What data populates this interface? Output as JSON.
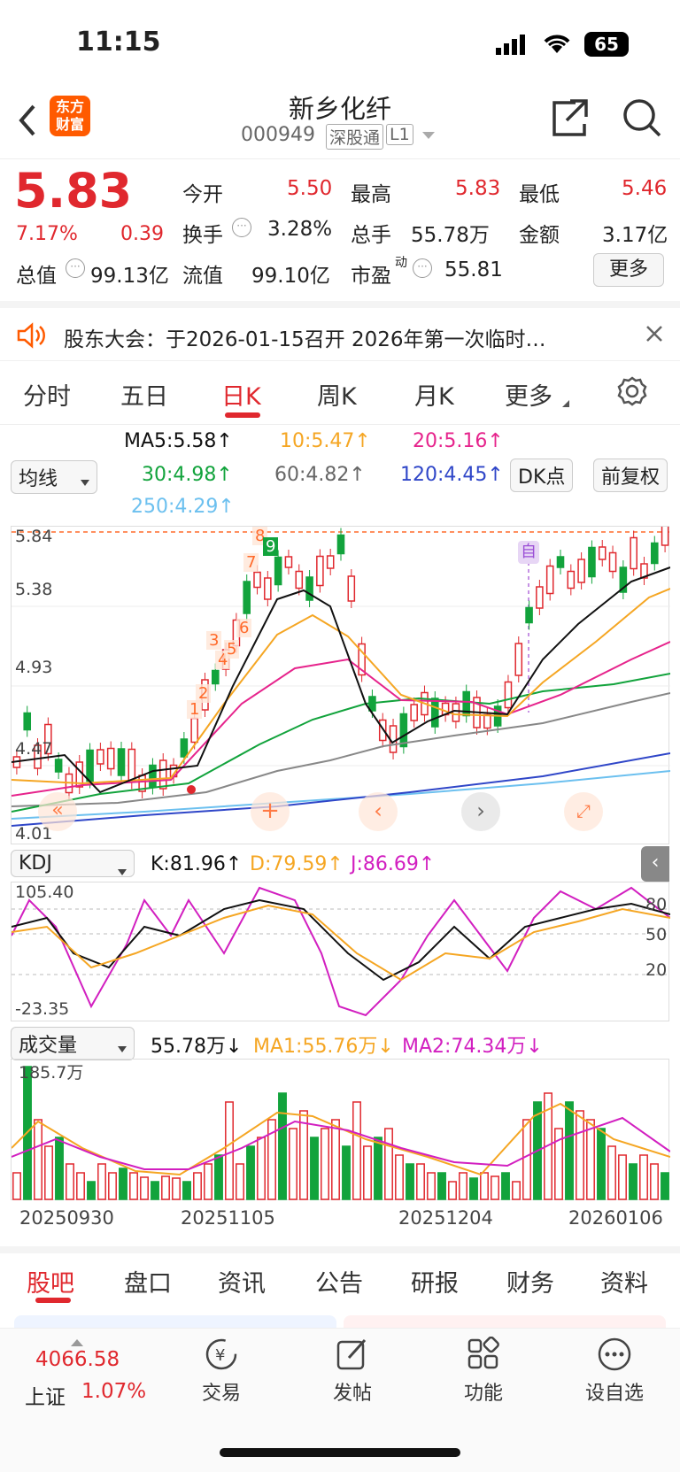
{
  "status_bar": {
    "time": "11:15",
    "battery": "65"
  },
  "nav": {
    "logo_text": "东方\n财富",
    "title": "新乡化纤",
    "code": "000949",
    "badge": "深股通",
    "level": "L1"
  },
  "quote": {
    "price": "5.83",
    "change_pct": "7.17%",
    "change": "0.39",
    "open_label": "今开",
    "open": "5.50",
    "high_label": "最高",
    "high": "5.83",
    "low_label": "最低",
    "low": "5.46",
    "turnover_label": "换手",
    "turnover": "3.28%",
    "volume_label": "总手",
    "volume": "55.78万",
    "amount_label": "金额",
    "amount": "3.17亿",
    "mktcap_label": "总值",
    "mktcap": "99.13亿",
    "float_label": "流值",
    "float": "99.10亿",
    "pe_label": "市盈",
    "pe_sup": "动",
    "pe": "55.81",
    "more": "更多"
  },
  "notice": {
    "text": "股东大会：于2026-01-15召开 2026年第一次临时…"
  },
  "tabs": [
    "分时",
    "五日",
    "日K",
    "周K",
    "月K",
    "更多"
  ],
  "ma_panel": {
    "selector": "均线",
    "dk": "DK点",
    "adjust": "前复权",
    "ma5": "MA5:5.58↑",
    "ma10": "10:5.47↑",
    "ma20": "20:5.16↑",
    "ma30": "30:4.98↑",
    "ma60": "60:4.82↑",
    "ma120": "120:4.45↑",
    "ma250": "250:4.29↑"
  },
  "kline": {
    "y_high": "5.84",
    "y_mid1": "5.38",
    "y_mid2": "4.93",
    "y_mid3": "4.47",
    "y_low": "4.01",
    "marker": "自",
    "num_labels": [
      "1",
      "2",
      "3",
      "4",
      "5",
      "6",
      "7",
      "8",
      "9"
    ]
  },
  "kdj": {
    "selector": "KDJ",
    "k": "K:81.96↑",
    "d": "D:79.59↑",
    "j": "J:86.69↑",
    "y_top": "105.40",
    "y_bottom": "-23.35",
    "r80": "80",
    "r50": "50",
    "r20": "20"
  },
  "volume_panel": {
    "selector": "成交量",
    "vol": "55.78万↓",
    "ma1": "MA1:55.76万↓",
    "ma2": "MA2:74.34万↓",
    "y_top": "185.7万"
  },
  "dates": [
    "20250930",
    "20251105",
    "20251204",
    "20260106"
  ],
  "bottom_tabs": [
    "股吧",
    "盘口",
    "资讯",
    "公告",
    "研报",
    "财务",
    "资料"
  ],
  "dock": {
    "index_value": "4066.58",
    "index_name": "上证",
    "index_pct": "1.07%",
    "items": [
      "交易",
      "发帖",
      "功能",
      "设自选"
    ]
  },
  "colors": {
    "up": "#e0282e",
    "down": "#12a33c",
    "accent": "#ff5a00"
  }
}
